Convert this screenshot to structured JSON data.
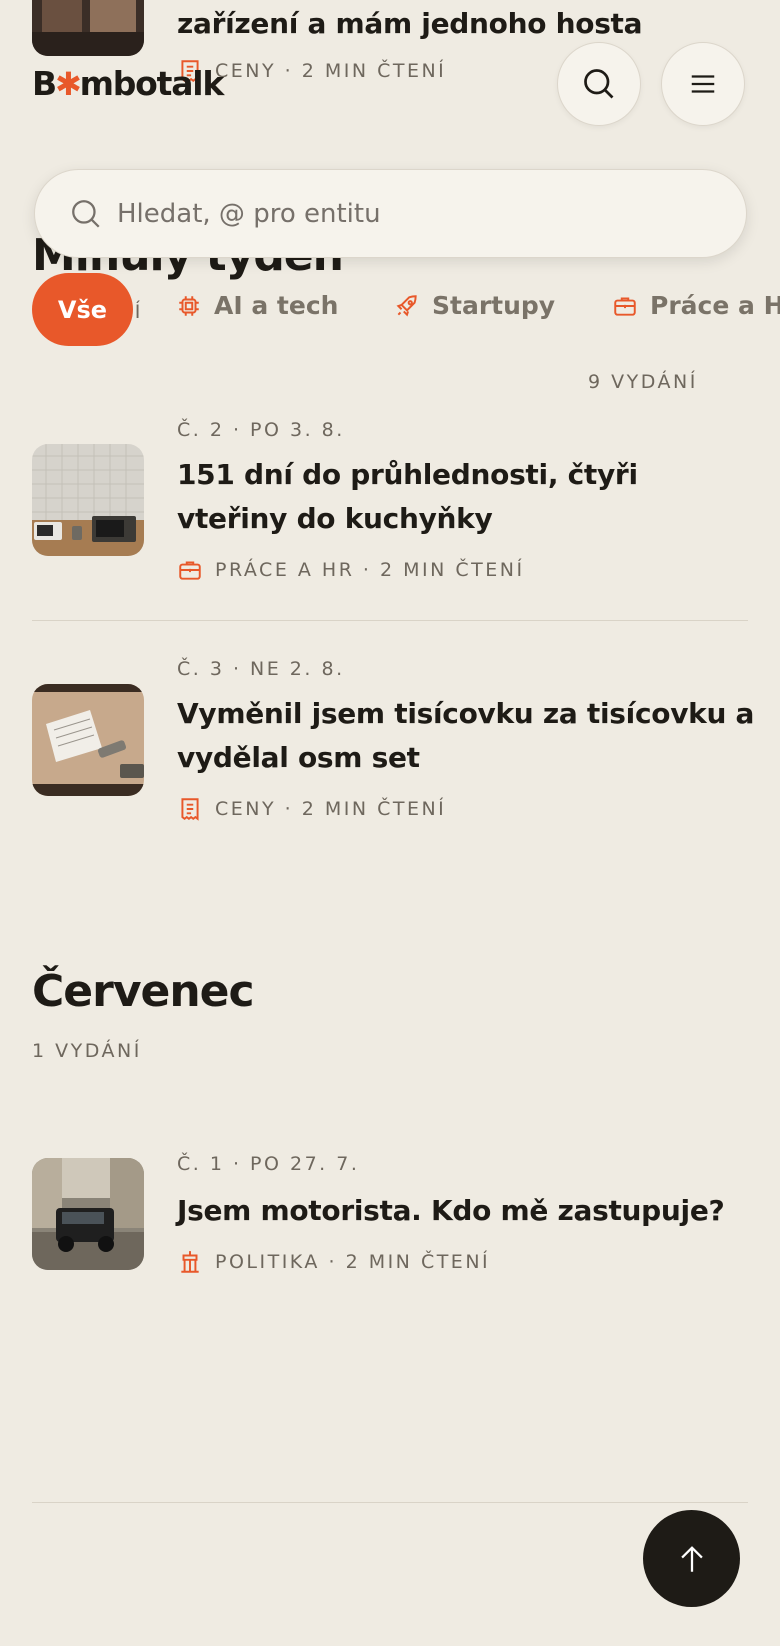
{
  "header": {
    "logo_prefix": "B",
    "logo_star": "✱",
    "logo_suffix": "mbotalk",
    "search_button_icon": "search-icon",
    "menu_button_icon": "menu-icon"
  },
  "search": {
    "placeholder": "Hledat, @ pro entitu"
  },
  "filters": {
    "active": "Vše",
    "chips": [
      {
        "label": "AI a tech",
        "icon": "chip-icon"
      },
      {
        "label": "Startupy",
        "icon": "rocket-icon"
      },
      {
        "label": "Práce a HR",
        "icon": "briefcase-icon"
      }
    ]
  },
  "partial_top": {
    "title": "zařízení a mám jednoho hosta",
    "category": "CENY",
    "read_time": "2 MIN ČTENÍ",
    "section_heading": "Minulý týden",
    "section_count_fragment": "NÍ"
  },
  "week_section": {
    "count": "9 VYDÁNÍ",
    "articles": [
      {
        "meta": "Č. 2 · PO 3. 8.",
        "title": "151 dní do průhlednosti, čtyři vteřiny do kuchyňky",
        "category": "PRÁCE A HR",
        "read_time": "2 MIN ČTENÍ",
        "category_icon": "briefcase-icon"
      },
      {
        "meta": "Č. 3 · NE 2. 8.",
        "title": "Vyměnil jsem tisícovku za tisícovku a vydělal osm set",
        "category": "CENY",
        "read_time": "2 MIN ČTENÍ",
        "category_icon": "receipt-icon"
      }
    ]
  },
  "july_section": {
    "heading": "Červenec",
    "count": "1 VYDÁNÍ",
    "articles": [
      {
        "meta": "Č. 1 · PO 27. 7.",
        "title": "Jsem motorista. Kdo mě zastupuje?",
        "category": "POLITIKA",
        "read_time": "2 MIN ČTENÍ",
        "category_icon": "government-icon"
      }
    ]
  },
  "fab": {
    "icon": "arrow-up-icon"
  },
  "colors": {
    "background": "#EFEBE2",
    "accent": "#E8582A",
    "text": "#1E1B16",
    "muted": "#6E675D"
  }
}
